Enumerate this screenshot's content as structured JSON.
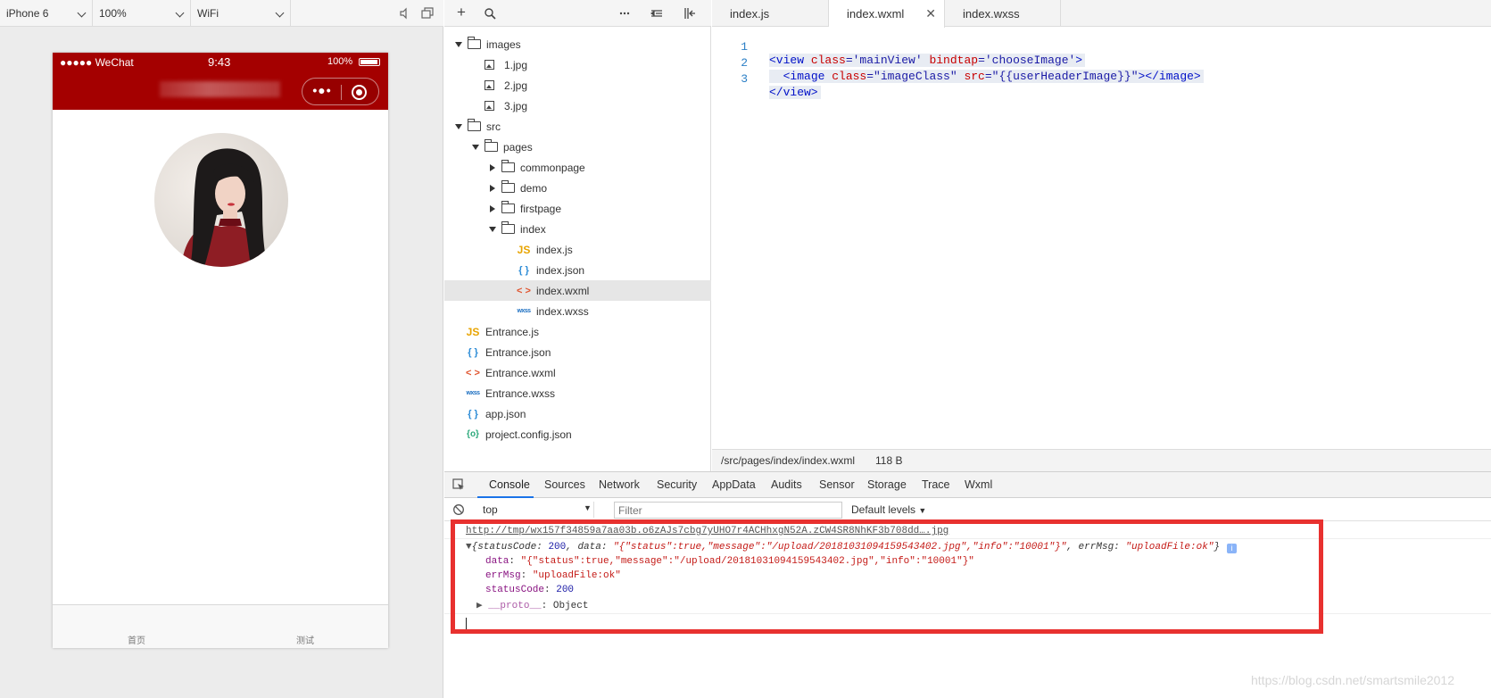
{
  "simulator": {
    "device": "iPhone 6",
    "zoom": "100%",
    "network": "WiFi",
    "status_bar": {
      "signal": "●●●●● WeChat",
      "time": "9:43",
      "battery": "100%"
    },
    "tabbar": [
      {
        "label": "首页"
      },
      {
        "label": "测试"
      }
    ]
  },
  "file_tree": [
    {
      "label": "images",
      "type": "folder",
      "state": "open",
      "depth": 0
    },
    {
      "label": "1.jpg",
      "type": "image",
      "depth": 1
    },
    {
      "label": "2.jpg",
      "type": "image",
      "depth": 1
    },
    {
      "label": "3.jpg",
      "type": "image",
      "depth": 1
    },
    {
      "label": "src",
      "type": "folder",
      "state": "open",
      "depth": 0
    },
    {
      "label": "pages",
      "type": "folder",
      "state": "open",
      "depth": 1
    },
    {
      "label": "commonpage",
      "type": "folder",
      "state": "closed",
      "depth": 2
    },
    {
      "label": "demo",
      "type": "folder",
      "state": "closed",
      "depth": 2
    },
    {
      "label": "firstpage",
      "type": "folder",
      "state": "closed",
      "depth": 2
    },
    {
      "label": "index",
      "type": "folder",
      "state": "open",
      "depth": 2
    },
    {
      "label": "index.js",
      "type": "js",
      "depth": 3
    },
    {
      "label": "index.json",
      "type": "json",
      "depth": 3
    },
    {
      "label": "index.wxml",
      "type": "wxml",
      "depth": 3,
      "selected": true
    },
    {
      "label": "index.wxss",
      "type": "wxss",
      "depth": 3
    },
    {
      "label": "Entrance.js",
      "type": "js",
      "depth": 0
    },
    {
      "label": "Entrance.json",
      "type": "json",
      "depth": 0
    },
    {
      "label": "Entrance.wxml",
      "type": "wxml",
      "depth": 0
    },
    {
      "label": "Entrance.wxss",
      "type": "wxss",
      "depth": 0
    },
    {
      "label": "app.json",
      "type": "json",
      "depth": 0
    },
    {
      "label": "project.config.json",
      "type": "config",
      "depth": 0
    }
  ],
  "icons": {
    "js": "JS",
    "json": "{ }",
    "wxml": "< >",
    "wxss": "wxss",
    "config": "{o}"
  },
  "editor": {
    "tabs": [
      {
        "label": "index.js"
      },
      {
        "label": "index.wxml",
        "active": true
      },
      {
        "label": "index.wxss"
      }
    ],
    "lines": [
      {
        "n": "1",
        "tag_open": "<view ",
        "attr1": "class",
        "val1": "='mainView'",
        "attr2": " bindtap",
        "val2": "='chooseImage'",
        "tag_close": ">"
      },
      {
        "n": "2",
        "indent": "  ",
        "tag_open": "<image ",
        "attr1": "class",
        "val1": "=\"imageClass\"",
        "attr2": " src",
        "val2": "=\"{{userHeaderImage}}\"",
        "tag_close": "></image>"
      },
      {
        "n": "3",
        "tag_open": "</view>"
      }
    ],
    "status_path": "/src/pages/index/index.wxml",
    "status_size": "118 B"
  },
  "devtools": {
    "tabs": [
      "Console",
      "Sources",
      "Network",
      "Security",
      "AppData",
      "Audits",
      "Sensor",
      "Storage",
      "Trace",
      "Wxml"
    ],
    "active_tab": "Console",
    "context": "top",
    "filter_placeholder": "Filter",
    "levels": "Default levels",
    "log": {
      "url": "http://tmp/wx157f34859a7aa03b.o6zAJs7cbg7yUHO7r4ACHhxgN52A.zCW4SR8NhKF3b708dd….jpg",
      "summary_prefix": "{statusCode: ",
      "summary_code": "200",
      "summary_mid": ", data: ",
      "summary_data": "\"{\"status\":true,\"message\":\"/upload/20181031094159543402.jpg\",\"info\":\"10001\"}\"",
      "summary_mid2": ", errMsg: ",
      "summary_err": "\"uploadFile:ok\"",
      "summary_end": "}",
      "data_key": "data",
      "data_val": "\"{\"status\":true,\"message\":\"/upload/20181031094159543402.jpg\",\"info\":\"10001\"}\"",
      "err_key": "errMsg",
      "err_val": "\"uploadFile:ok\"",
      "code_key": "statusCode",
      "code_val": "200",
      "proto_key": "__proto__",
      "proto_val": "Object"
    }
  },
  "watermark": "https://blog.csdn.net/smartsmile2012",
  "colors": {
    "nav_bg": "#a40000",
    "highlight_box": "#e8312f",
    "tab_underline": "#1a73e8"
  }
}
